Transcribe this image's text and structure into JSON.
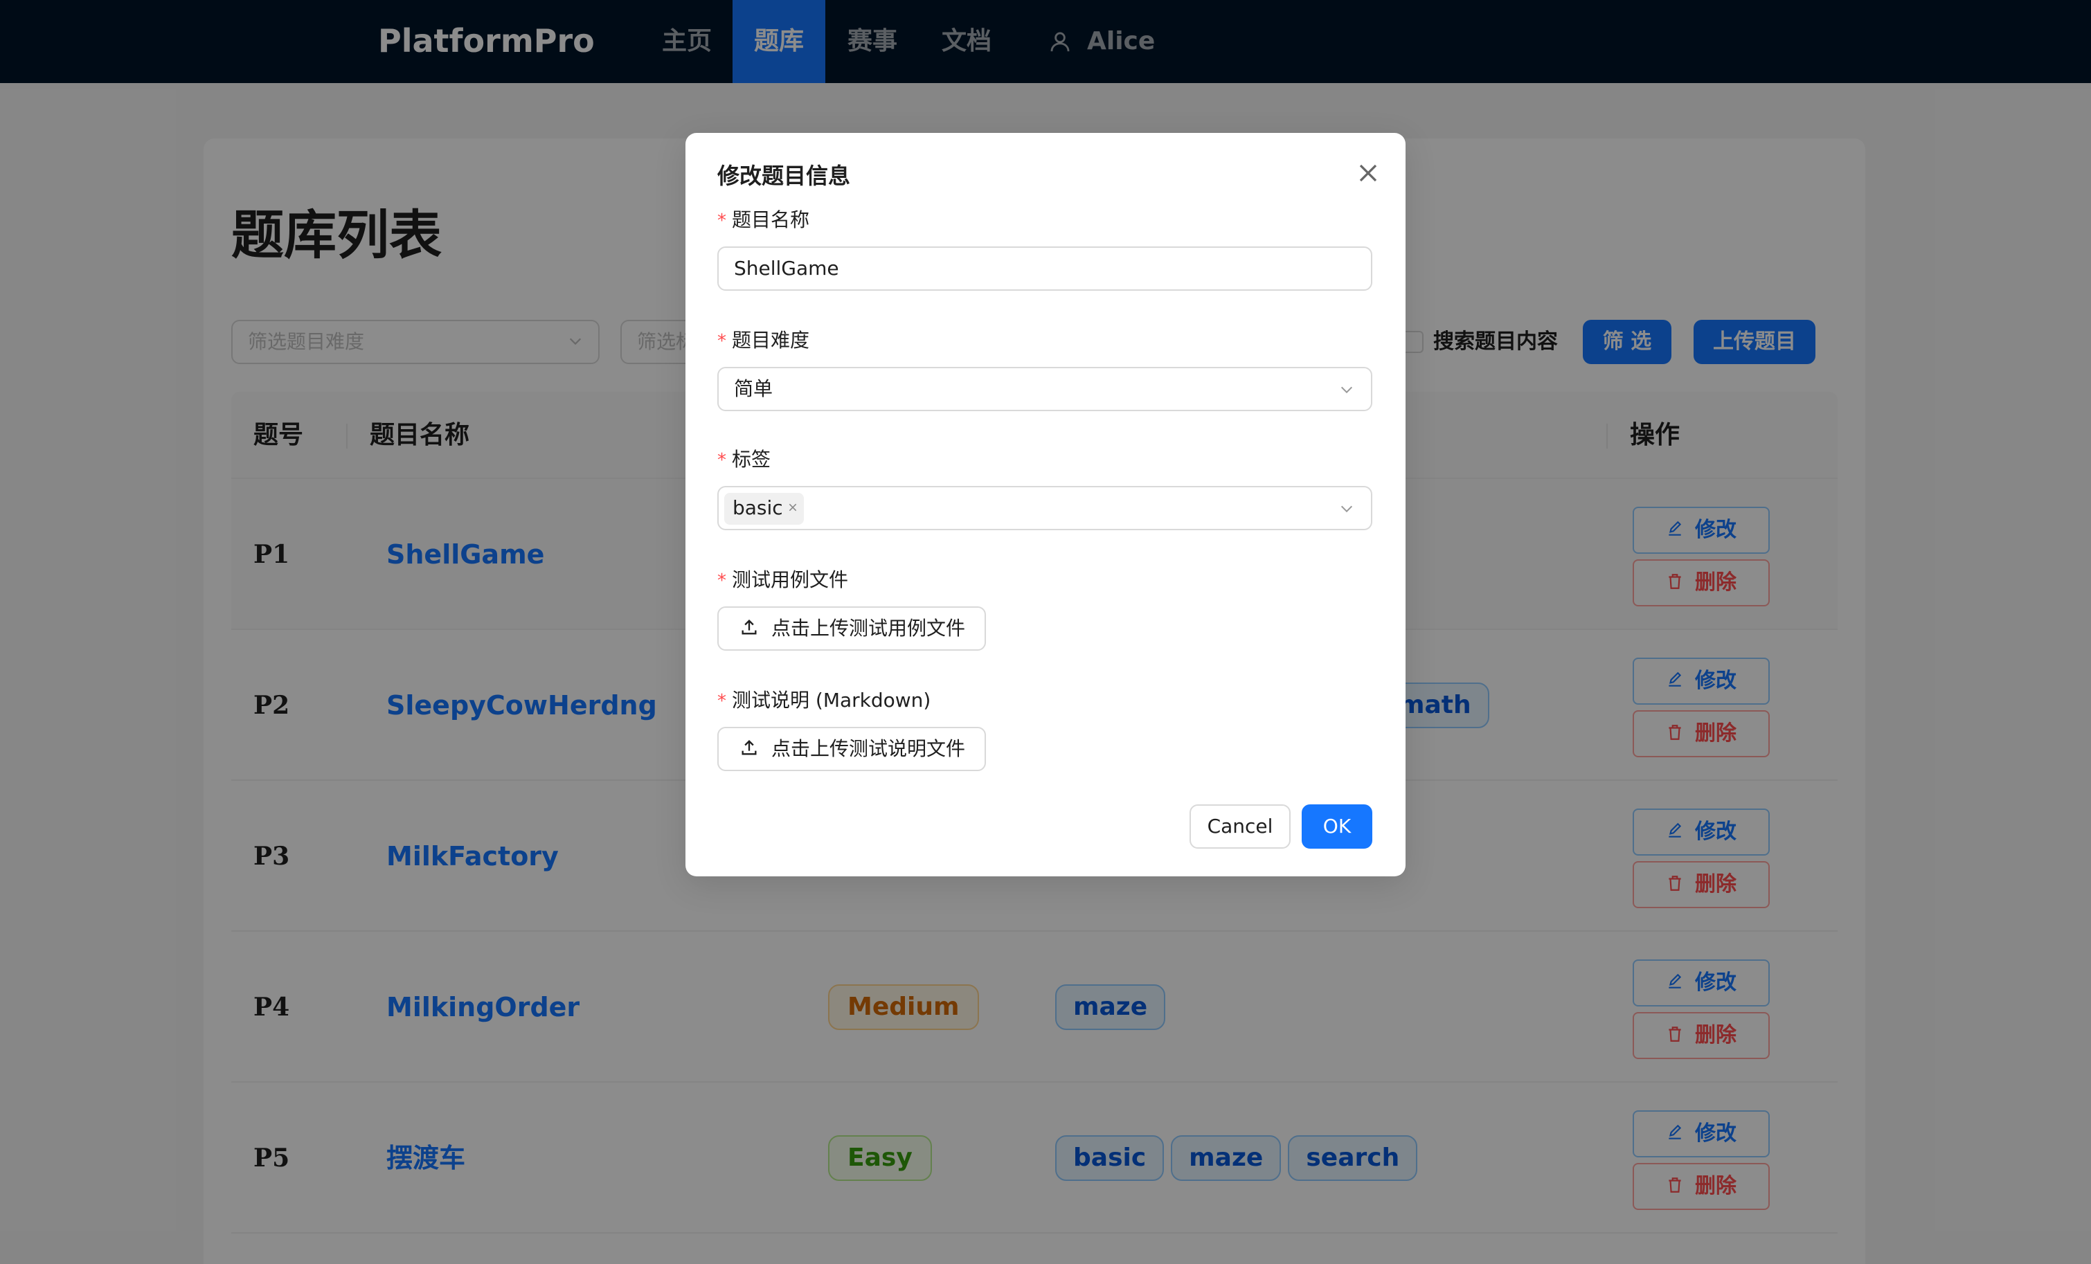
{
  "nav": {
    "brand": "PlatformPro",
    "items": [
      {
        "label": "主页"
      },
      {
        "label": "题库",
        "active": true
      },
      {
        "label": "赛事"
      },
      {
        "label": "文档"
      }
    ],
    "user": "Alice"
  },
  "page": {
    "title": "题库列表",
    "filter_difficulty_placeholder": "筛选题目难度",
    "filter_tag_placeholder": "筛选标",
    "search_content_label": "搜索题目内容",
    "filter_button": "筛 选",
    "upload_button": "上传题目"
  },
  "table": {
    "headers": {
      "id": "题号",
      "name": "题目名称",
      "action": "操作"
    },
    "edit_label": "修改",
    "delete_label": "删除",
    "rows": [
      {
        "id": "P1",
        "name": "ShellGame",
        "difficulty": "",
        "tags": []
      },
      {
        "id": "P2",
        "name": "SleepyCowHerdng",
        "difficulty": "",
        "tags": [
          "math"
        ]
      },
      {
        "id": "P3",
        "name": "MilkFactory",
        "difficulty": "",
        "tags": []
      },
      {
        "id": "P4",
        "name": "MilkingOrder",
        "difficulty": "Medium",
        "tags": [
          "maze"
        ]
      },
      {
        "id": "P5",
        "name": "摆渡车",
        "difficulty": "Easy",
        "tags": [
          "basic",
          "maze",
          "search"
        ]
      }
    ]
  },
  "modal": {
    "title": "修改题目信息",
    "name_label": "题目名称",
    "name_value": "ShellGame",
    "difficulty_label": "题目难度",
    "difficulty_value": "简单",
    "tags_label": "标签",
    "tags": [
      "basic"
    ],
    "testcase_label": "测试用例文件",
    "testcase_button": "点击上传测试用例文件",
    "desc_label": "测试说明 (Markdown)",
    "desc_button": "点击上传测试说明文件",
    "cancel_label": "Cancel",
    "ok_label": "OK"
  },
  "colors": {
    "nav_bg": "#001529",
    "primary": "#1677ff",
    "danger": "#ff4d4f",
    "medium_tag": "#d46b08",
    "easy_tag": "#389e0d"
  },
  "icons": [
    "user-icon",
    "chevron-down-icon",
    "edit-icon",
    "delete-icon",
    "close-icon",
    "upload-icon"
  ]
}
